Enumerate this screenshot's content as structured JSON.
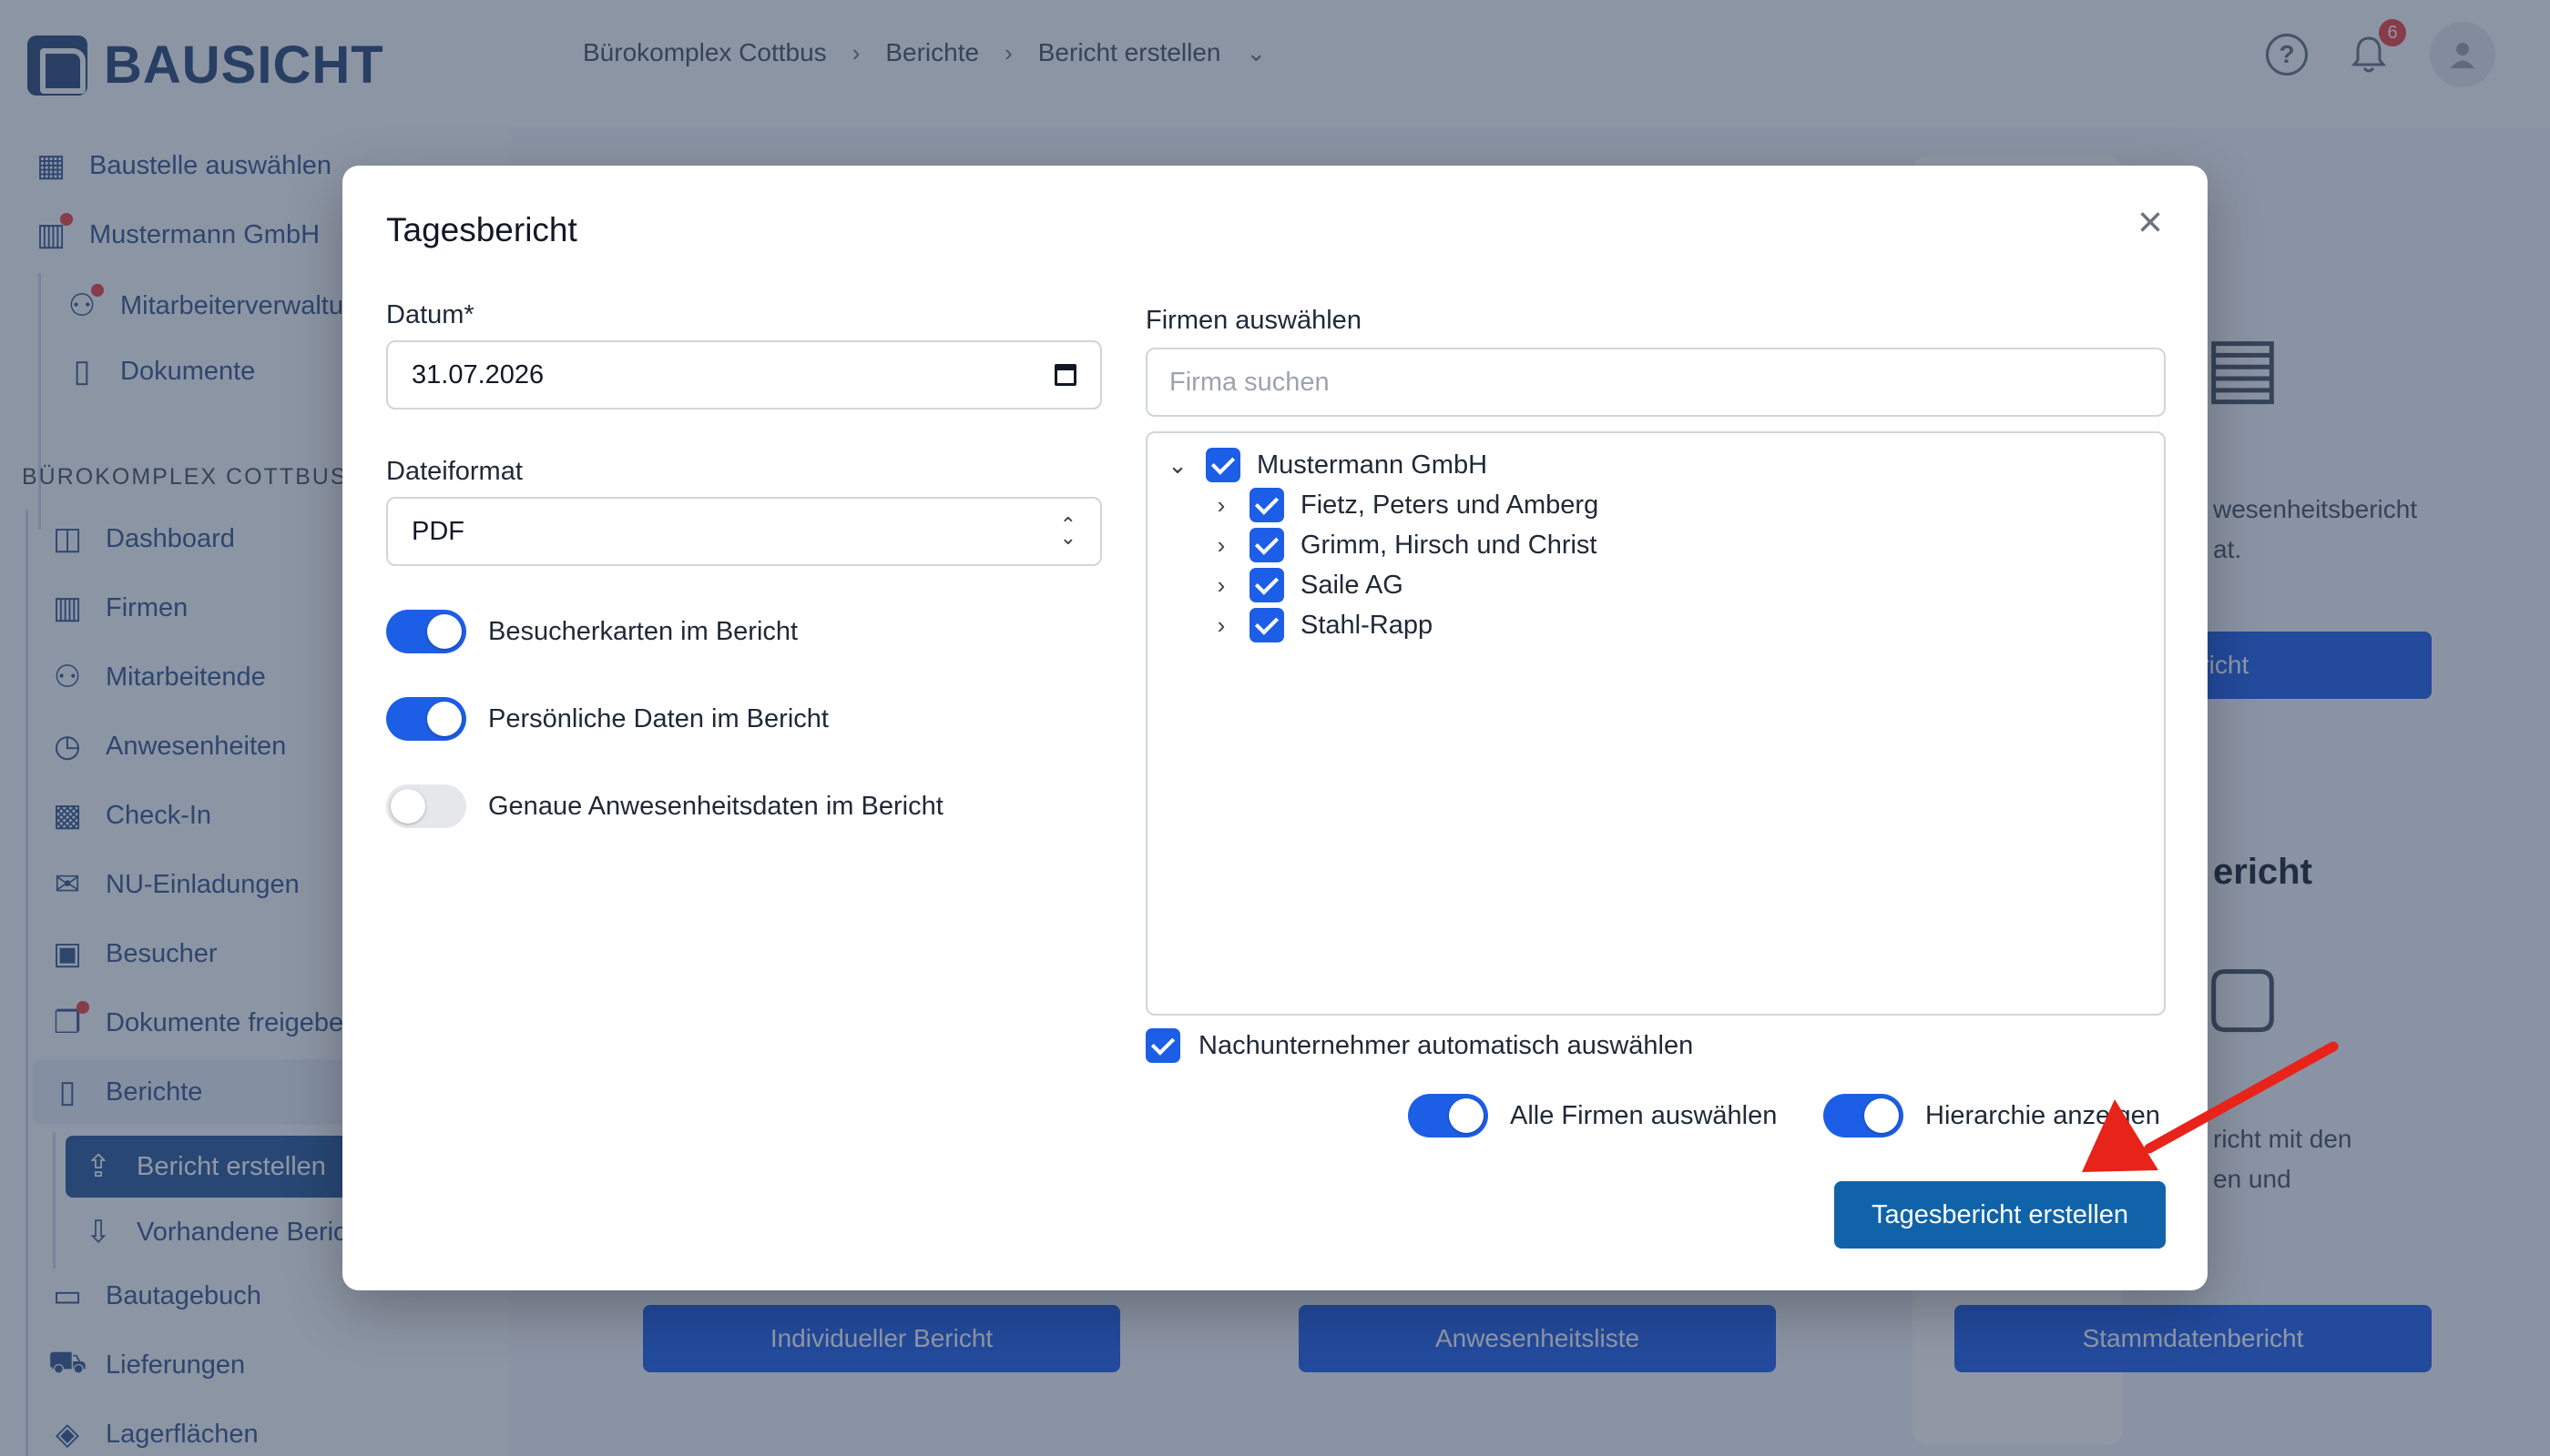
{
  "app": {
    "logo_text": "BAUSICHT",
    "breadcrumb": [
      "Bürokomplex Cottbus",
      "Berichte",
      "Bericht erstellen"
    ],
    "notification_count": "6",
    "help_glyph": "?"
  },
  "sidebar": {
    "top_items": [
      {
        "label": "Baustelle auswählen",
        "icon": "grid-icon"
      },
      {
        "label": "Mustermann GmbH",
        "icon": "building-icon"
      },
      {
        "label": "Mitarbeiterverwaltung",
        "icon": "users-icon"
      },
      {
        "label": "Dokumente",
        "icon": "document-icon"
      }
    ],
    "section_title": "BÜROKOMPLEX COTTBUS",
    "items": [
      {
        "label": "Dashboard",
        "icon": "dashboard-icon"
      },
      {
        "label": "Firmen",
        "icon": "building-icon"
      },
      {
        "label": "Mitarbeitende",
        "icon": "users-icon"
      },
      {
        "label": "Anwesenheiten",
        "icon": "clock-icon"
      },
      {
        "label": "Check-In",
        "icon": "qr-code-icon"
      },
      {
        "label": "NU-Einladungen",
        "icon": "mail-icon"
      },
      {
        "label": "Besucher",
        "icon": "id-card-icon"
      },
      {
        "label": "Dokumente freigeben",
        "icon": "documents-icon"
      },
      {
        "label": "Berichte",
        "icon": "report-icon"
      },
      {
        "label": "Bericht erstellen",
        "icon": "file-upload-icon"
      },
      {
        "label": "Vorhandene Berichte",
        "icon": "file-download-icon"
      },
      {
        "label": "Bautagebuch",
        "icon": "book-icon"
      },
      {
        "label": "Lieferungen",
        "icon": "truck-icon"
      },
      {
        "label": "Lagerflächen",
        "icon": "layers-icon"
      }
    ]
  },
  "background_cards": {
    "card1_text_1": "wesenheitsbericht",
    "card1_text_2": "at.",
    "card1_button": "ericht",
    "card2_title": "ericht",
    "card2_text_1": "richt mit den",
    "card2_text_2": "en und",
    "bottom_buttons": [
      "Individueller Bericht",
      "Anwesenheitsliste",
      "Stammdatenbericht"
    ]
  },
  "modal": {
    "title": "Tagesbericht",
    "date_label": "Datum*",
    "date_value": "31.07.2026",
    "format_label": "Dateiformat",
    "format_value": "PDF",
    "toggles": [
      {
        "label": "Besucherkarten im Bericht",
        "on": true
      },
      {
        "label": "Persönliche Daten im Bericht",
        "on": true
      },
      {
        "label": "Genaue Anwesenheitsdaten im Bericht",
        "on": false
      }
    ],
    "companies_label": "Firmen auswählen",
    "search_placeholder": "Firma suchen",
    "tree": {
      "root": {
        "label": "Mustermann GmbH",
        "checked": true,
        "expanded": true
      },
      "children": [
        {
          "label": "Fietz, Peters und Amberg",
          "checked": true
        },
        {
          "label": "Grimm, Hirsch und Christ",
          "checked": true
        },
        {
          "label": "Saile AG",
          "checked": true
        },
        {
          "label": "Stahl-Rapp",
          "checked": true
        }
      ]
    },
    "auto_select_label": "Nachunternehmer automatisch auswählen",
    "auto_select_checked": true,
    "select_all_label": "Alle Firmen auswählen",
    "select_all_on": true,
    "hierarchy_label": "Hierarchie anzeigen",
    "hierarchy_on": true,
    "submit_label": "Tagesbericht erstellen"
  },
  "colors": {
    "primary": "#1063a9",
    "toggle_on": "#1d5ee6",
    "annotation_arrow": "#e8231a",
    "overlay": "#21314e"
  }
}
